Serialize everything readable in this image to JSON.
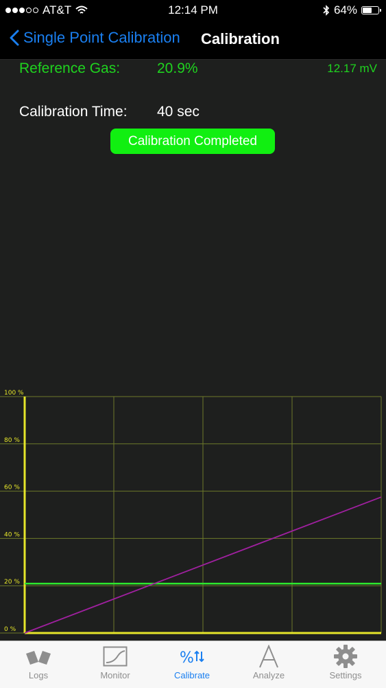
{
  "status_bar": {
    "carrier": "AT&T",
    "time": "12:14 PM",
    "battery": "64%",
    "battery_level": 0.64,
    "signal_bars": 3,
    "signal_total": 5
  },
  "nav": {
    "back_label": "Single Point Calibration",
    "title": "Calibration"
  },
  "reference": {
    "label": "Reference Gas:",
    "value": "20.9%",
    "mv": "12.17 mV"
  },
  "calibration_time": {
    "label": "Calibration Time:",
    "value": "40 sec"
  },
  "status_button": "Calibration Completed",
  "colors": {
    "green_text": "#1fd31f",
    "button_green": "#11ef11",
    "accent_blue": "#1a7ff0",
    "axis_yellow": "#e6e62a",
    "grid": "#6d7a2a",
    "reference_line": "#2ee82e",
    "trend_line": "#a020a0"
  },
  "chart_data": {
    "type": "line",
    "y_tick_labels": [
      "100 %",
      "80 %",
      "60 %",
      "40 %",
      "20 %",
      "0 %"
    ],
    "y_ticks": [
      100,
      80,
      60,
      40,
      20,
      0
    ],
    "ylim": [
      0,
      100
    ],
    "xlim": [
      0,
      4
    ],
    "x_divisions": 4,
    "grid": true,
    "series": [
      {
        "key": "reference",
        "color": "#2ee82e",
        "x": [
          0,
          4
        ],
        "y": [
          20.9,
          20.9
        ]
      },
      {
        "key": "trend",
        "color": "#a020a0",
        "x": [
          0,
          4
        ],
        "y": [
          0,
          57.5
        ]
      }
    ]
  },
  "tabs": [
    {
      "label": "Logs",
      "icon": "logs-icon",
      "active": false
    },
    {
      "label": "Monitor",
      "icon": "monitor-icon",
      "active": false
    },
    {
      "label": "Calibrate",
      "icon": "calibrate-icon",
      "active": true
    },
    {
      "label": "Analyze",
      "icon": "analyze-icon",
      "active": false
    },
    {
      "label": "Settings",
      "icon": "gear-icon",
      "active": false
    }
  ]
}
